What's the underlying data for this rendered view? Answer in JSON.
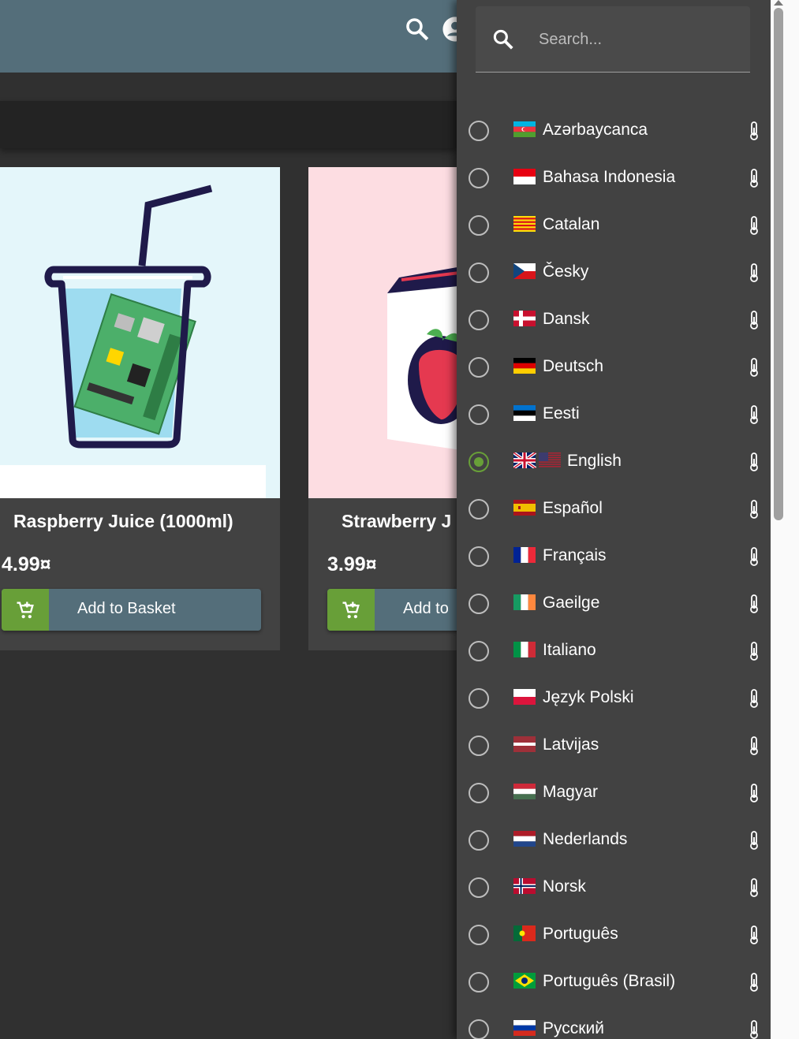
{
  "header": {
    "search_icon": "search-icon",
    "account_icon": "account-icon"
  },
  "products": [
    {
      "name": "Raspberry Juice (1000ml)",
      "price": "4.99¤",
      "button_label": "Add to Basket"
    },
    {
      "name": "Strawberry J",
      "price": "3.99¤",
      "button_label": "Add to"
    }
  ],
  "language_panel": {
    "search_placeholder": "Search...",
    "selected": "English",
    "languages": [
      {
        "label": "Azərbaycanca",
        "flag": "az"
      },
      {
        "label": "Bahasa Indonesia",
        "flag": "id"
      },
      {
        "label": "Catalan",
        "flag": "ca"
      },
      {
        "label": "Česky",
        "flag": "cz"
      },
      {
        "label": "Dansk",
        "flag": "dk"
      },
      {
        "label": "Deutsch",
        "flag": "de"
      },
      {
        "label": "Eesti",
        "flag": "ee"
      },
      {
        "label": "English",
        "flag": "gb-us"
      },
      {
        "label": "Español",
        "flag": "es"
      },
      {
        "label": "Français",
        "flag": "fr"
      },
      {
        "label": "Gaeilge",
        "flag": "ie"
      },
      {
        "label": "Italiano",
        "flag": "it"
      },
      {
        "label": "Język Polski",
        "flag": "pl"
      },
      {
        "label": "Latvijas",
        "flag": "lv"
      },
      {
        "label": "Magyar",
        "flag": "hu"
      },
      {
        "label": "Nederlands",
        "flag": "nl"
      },
      {
        "label": "Norsk",
        "flag": "no"
      },
      {
        "label": "Português",
        "flag": "pt"
      },
      {
        "label": "Português (Brasil)",
        "flag": "br"
      },
      {
        "label": "Русский",
        "flag": "ru"
      }
    ]
  },
  "colors": {
    "toolbar": "#546e7a",
    "accent": "#689f38",
    "panel": "#424242",
    "background": "#303030"
  }
}
